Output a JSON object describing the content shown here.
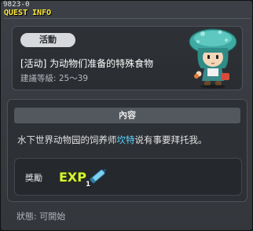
{
  "window": {
    "quest_id": "9823-0",
    "title": "QUEST INFO"
  },
  "summary": {
    "tag": "活動",
    "quest_name": "[活动] 为动物们准备的特殊食物",
    "level_requirement": "建議等級: 25～39",
    "npc_icon": "mushroom-hat-girl-icon"
  },
  "content": {
    "header": "內容",
    "text_before": "水下世界动物园的饲养师",
    "npc_name": "坎特",
    "text_after": "说有事要拜托我。",
    "npc_name_color": "#5bd8ff"
  },
  "reward": {
    "label": "獎勵",
    "exp_icon": "exp-icon",
    "exp_text": "EXP",
    "count": "1"
  },
  "status": {
    "text": "狀態:  可開始"
  },
  "colors": {
    "title": "#ffe93a",
    "background": "#33363b",
    "accent_link": "#5bd8ff"
  }
}
